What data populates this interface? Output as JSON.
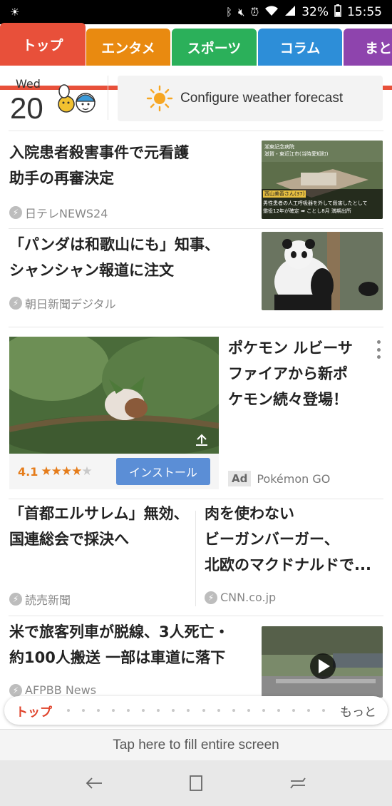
{
  "status": {
    "battery": "32%",
    "time": "15:55",
    "icons": [
      "brightness-icon",
      "bluetooth-icon",
      "mute-icon",
      "alarm-icon",
      "wifi-icon",
      "signal-icon",
      "battery-icon"
    ]
  },
  "tabs": [
    {
      "label": "トップ",
      "color": "#e8503a",
      "active": true
    },
    {
      "label": "エンタメ",
      "color": "#e98a10",
      "active": false
    },
    {
      "label": "スポーツ",
      "color": "#2bb05a",
      "active": false
    },
    {
      "label": "コラム",
      "color": "#2d8ed8",
      "active": false
    },
    {
      "label": "まと",
      "color": "#8e44ad",
      "active": false
    }
  ],
  "weather": {
    "day": "Wed",
    "date": "20",
    "configure_label": "Configure weather forecast"
  },
  "articles": [
    {
      "headline_line1": "入院患者殺害事件で元看護",
      "headline_line2": "助手の再審決定",
      "source": "日テレNEWS24",
      "thumb_caption_top": "湖東記念病院",
      "thumb_caption_sub": "滋賀・東近江市(当時愛知町)",
      "thumb_caption_name": "西山美香さん(37)",
      "thumb_caption_bottom1": "男性患者の人工呼吸器を外して殺害したとして",
      "thumb_caption_bottom2": "懲役12年が確定 ➡ ことし8月 満期出所"
    },
    {
      "headline_line1": "「パンダは和歌山にも」知事、",
      "headline_line2": "シャンシャン報道に注文",
      "source": "朝日新聞デジタル"
    },
    {
      "headline_line1": "「首都エルサレム」無効、",
      "headline_line2": "国連総会で採決へ",
      "source": "読売新聞"
    },
    {
      "headline_line1": "肉を使わない",
      "headline_line2": "ビーガンバーガー、",
      "headline_line3": "北欧のマクドナルドで...",
      "source": "CNN.co.jp"
    },
    {
      "headline_line1": "米で旅客列車が脱線、3人死亡・",
      "headline_line2": "約100人搬送 一部は車道に落下",
      "source": "AFPBB News"
    }
  ],
  "ad": {
    "headline_line1": "ポケモン ルビーサ",
    "headline_line2": "ファイアから新ポ",
    "headline_line3": "ケモン続々登場！",
    "rating": "4.1",
    "rating_value": 4.1,
    "rating_max": 5,
    "install_label": "インストール",
    "badge": "Ad",
    "advertiser": "Pokémon GO"
  },
  "pager": {
    "current": "トップ",
    "more": "もっと",
    "dot_count": 18
  },
  "fill_screen_label": "Tap here to fill entire screen",
  "navbar": {
    "icons": [
      "back-icon",
      "recents-icon",
      "overview-icon"
    ]
  }
}
